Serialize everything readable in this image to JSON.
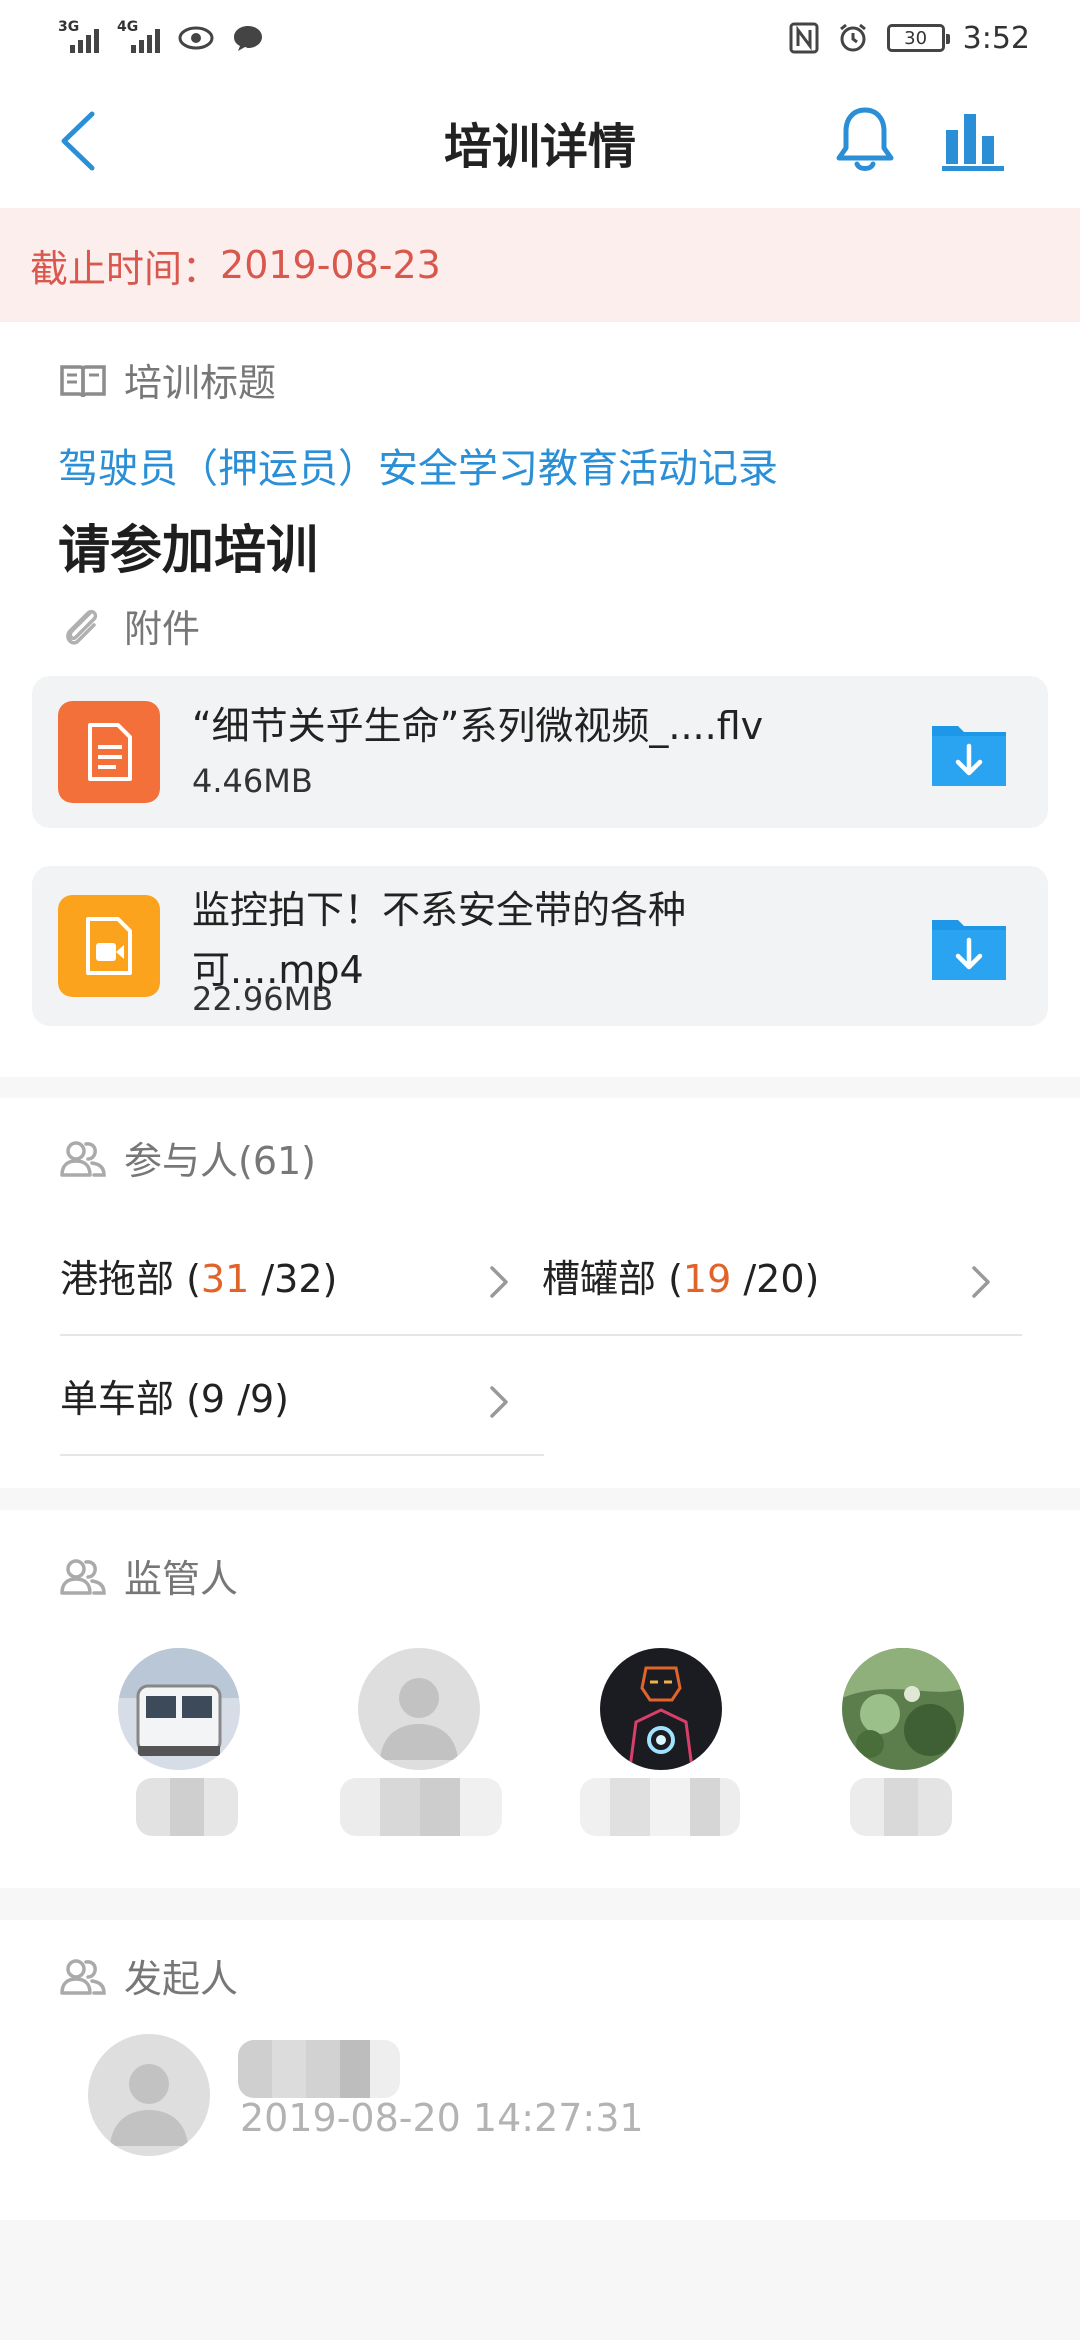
{
  "status_bar": {
    "net1": "3G",
    "net2": "4G",
    "battery": "30",
    "time": "3:52"
  },
  "header": {
    "title": "培训详情"
  },
  "deadline": {
    "label": "截止时间：",
    "value": "2019-08-23"
  },
  "training": {
    "section_label": "培训标题",
    "title": "驾驶员（押运员）安全学习教育活动记录",
    "subtitle": "请参加培训",
    "attachments_label": "附件",
    "attachments": [
      {
        "name": "“细节关乎生命”系列微视频_....flv",
        "size": "4.46MB"
      },
      {
        "name": "监控拍下！不系安全带的各种可....mp4",
        "size": "22.96MB"
      }
    ]
  },
  "participants": {
    "label": "参与人(61)",
    "departments": [
      {
        "name": "港拖部",
        "done": "31",
        "total": "/32)"
      },
      {
        "name": "槽罐部",
        "done": "19",
        "total": "/20)"
      },
      {
        "name": "单车部",
        "done": "9",
        "total": "/9)"
      }
    ]
  },
  "supervisors": {
    "label": "监管人"
  },
  "initiator": {
    "label": "发起人",
    "datetime": "2019-08-20 14:27:31"
  },
  "colors": {
    "accent": "#2a8fd6",
    "deadline": "#d9584d",
    "highlight": "#e0642a"
  },
  "icons": [
    "back-icon",
    "bell-icon",
    "stats-icon",
    "book-icon",
    "paperclip-icon",
    "document-icon",
    "video-icon",
    "download-folder-icon",
    "people-icon",
    "chevron-right-icon"
  ]
}
